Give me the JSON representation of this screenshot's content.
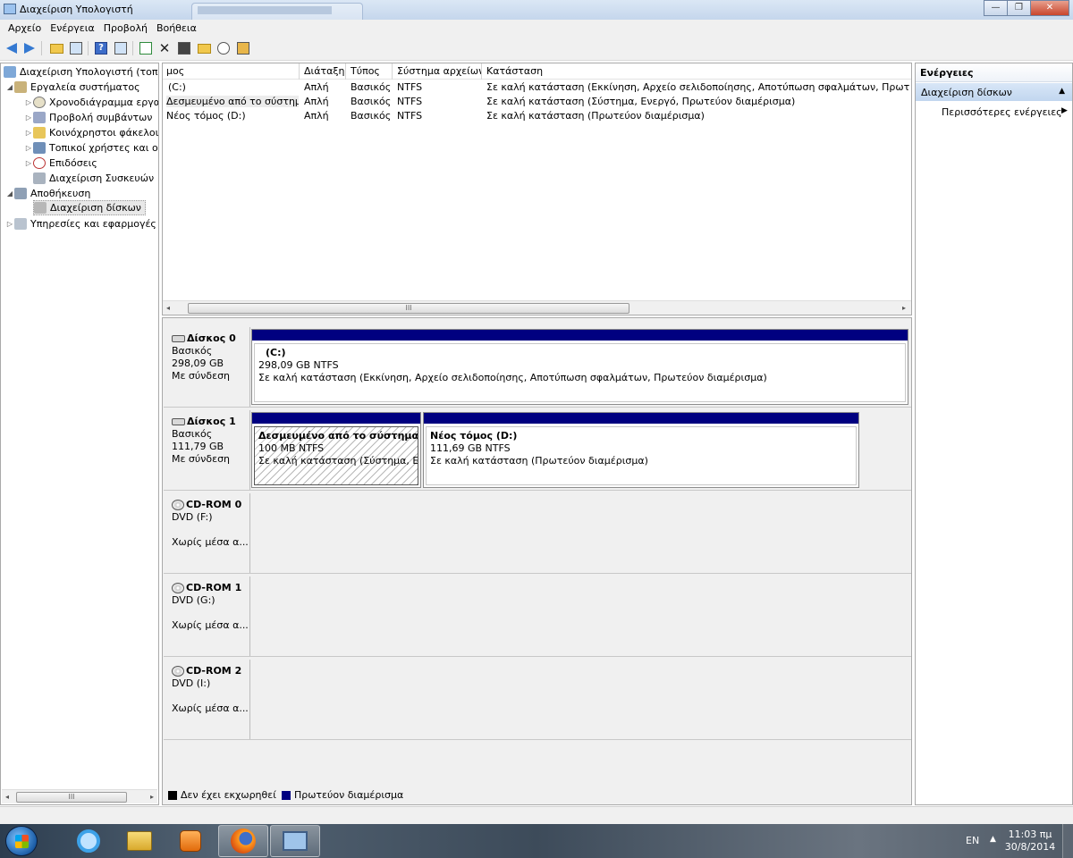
{
  "window": {
    "title": "Διαχείριση Υπολογιστή"
  },
  "menu": [
    "Αρχείο",
    "Ενέργεια",
    "Προβολή",
    "Βοήθεια"
  ],
  "tree": {
    "items": [
      {
        "label": "Διαχείριση Υπολογιστή (τοπικός",
        "icon": "computer-icon"
      },
      {
        "label": "Εργαλεία συστήματος",
        "icon": "tools-icon"
      },
      {
        "label": "Χρονοδιάγραμμα εργασιών",
        "icon": "clock-icon"
      },
      {
        "label": "Προβολή συμβάντων",
        "icon": "event-viewer-icon"
      },
      {
        "label": "Κοινόχρηστοι φάκελοι",
        "icon": "shared-folder-icon"
      },
      {
        "label": "Τοπικοί χρήστες και ομάδες",
        "icon": "users-icon"
      },
      {
        "label": "Επιδόσεις",
        "icon": "performance-icon"
      },
      {
        "label": "Διαχείριση Συσκευών",
        "icon": "device-manager-icon"
      },
      {
        "label": "Αποθήκευση",
        "icon": "storage-icon"
      },
      {
        "label": "Διαχείριση δίσκων",
        "icon": "disk-management-icon"
      },
      {
        "label": "Υπηρεσίες και εφαρμογές",
        "icon": "services-icon"
      }
    ],
    "scroll_thumb_label": "III"
  },
  "volumes": {
    "columns": [
      "μος",
      "Διάταξη",
      "Τύπος",
      "Σύστημα αρχείων",
      "Κατάσταση"
    ],
    "rows": [
      {
        "volume": "(C:)",
        "layout": "Απλή",
        "type": "Βασικός",
        "fs": "NTFS",
        "status": "Σε καλή κατάσταση (Εκκίνηση, Αρχείο σελιδοποίησης, Αποτύπωση σφαλμάτων, Πρωτεύον διαμέρισμα)"
      },
      {
        "volume": "Δεσμευμένο από το σύστημα",
        "layout": "Απλή",
        "type": "Βασικός",
        "fs": "NTFS",
        "status": "Σε καλή κατάσταση (Σύστημα, Ενεργό, Πρωτεύον διαμέρισμα)"
      },
      {
        "volume": "Νέος τόμος (D:)",
        "layout": "Απλή",
        "type": "Βασικός",
        "fs": "NTFS",
        "status": "Σε καλή κατάσταση (Πρωτεύον διαμέρισμα)"
      }
    ],
    "scroll_thumb_label": "III"
  },
  "disks": [
    {
      "name": "Δίσκος 0",
      "kind": "Βασικός",
      "size": "298,09 GB",
      "state": "Με σύνδεση",
      "partitions": [
        {
          "name": "(C:)",
          "size": "298,09 GB NTFS",
          "status": "Σε καλή κατάσταση (Εκκίνηση, Αρχείο σελιδοποίησης, Αποτύπωση σφαλμάτων, Πρωτεύον διαμέρισμα)"
        }
      ]
    },
    {
      "name": "Δίσκος 1",
      "kind": "Βασικός",
      "size": "111,79 GB",
      "state": "Με σύνδεση",
      "partitions": [
        {
          "name": "Δεσμευμένο από το σύστημα",
          "size": "100 MB NTFS",
          "status": "Σε καλή κατάσταση (Σύστημα, Ενεργό, Πρωτεύον διαμέρισμα)"
        },
        {
          "name": "Νέος τόμος  (D:)",
          "size": "111,69 GB NTFS",
          "status": "Σε καλή κατάσταση (Πρωτεύον διαμέρισμα)"
        }
      ]
    },
    {
      "name": "CD-ROM 0",
      "kind": "DVD (F:)",
      "state": "Χωρίς μέσα α..."
    },
    {
      "name": "CD-ROM 1",
      "kind": "DVD (G:)",
      "state": "Χωρίς μέσα α..."
    },
    {
      "name": "CD-ROM 2",
      "kind": "DVD (I:)",
      "state": "Χωρίς μέσα α..."
    }
  ],
  "legend": [
    {
      "label": "Δεν έχει εκχωρηθεί",
      "color": "#000000"
    },
    {
      "label": "Πρωτεύον διαμέρισμα",
      "color": "#000080"
    }
  ],
  "actions": {
    "header": "Ενέργειες",
    "section": "Διαχείριση δίσκων",
    "more": "Περισσότερες ενέργειες"
  },
  "taskbar": {
    "apps": [
      "internet-explorer-icon",
      "file-explorer-icon",
      "media-player-icon",
      "firefox-icon",
      "computer-management-icon"
    ],
    "language": "EN",
    "time": "11:03 πμ",
    "date": "30/8/2014"
  }
}
